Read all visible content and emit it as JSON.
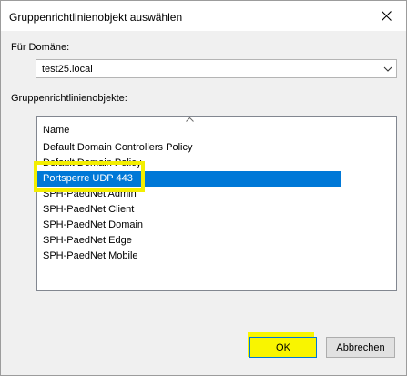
{
  "window": {
    "title": "Gruppenrichtlinienobjekt auswählen"
  },
  "domain": {
    "label": "Für Domäne:",
    "selected": "test25.local"
  },
  "gpo": {
    "label": "Gruppenrichtlinienobjekte:",
    "column_header": "Name",
    "sort": "ascending",
    "items": [
      {
        "name": "Default Domain Controllers Policy",
        "selected": false
      },
      {
        "name": "Default Domain Policy",
        "selected": false
      },
      {
        "name": "Portsperre UDP 443",
        "selected": true
      },
      {
        "name": "SPH-PaedNet Admin",
        "selected": false
      },
      {
        "name": "SPH-PaedNet Client",
        "selected": false
      },
      {
        "name": "SPH-PaedNet Domain",
        "selected": false
      },
      {
        "name": "SPH-PaedNet Edge",
        "selected": false
      },
      {
        "name": "SPH-PaedNet Mobile",
        "selected": false
      }
    ]
  },
  "buttons": {
    "ok": "OK",
    "cancel": "Abbrechen"
  },
  "colors": {
    "selection": "#0078d7",
    "highlight_marker": "#f3ee00"
  }
}
